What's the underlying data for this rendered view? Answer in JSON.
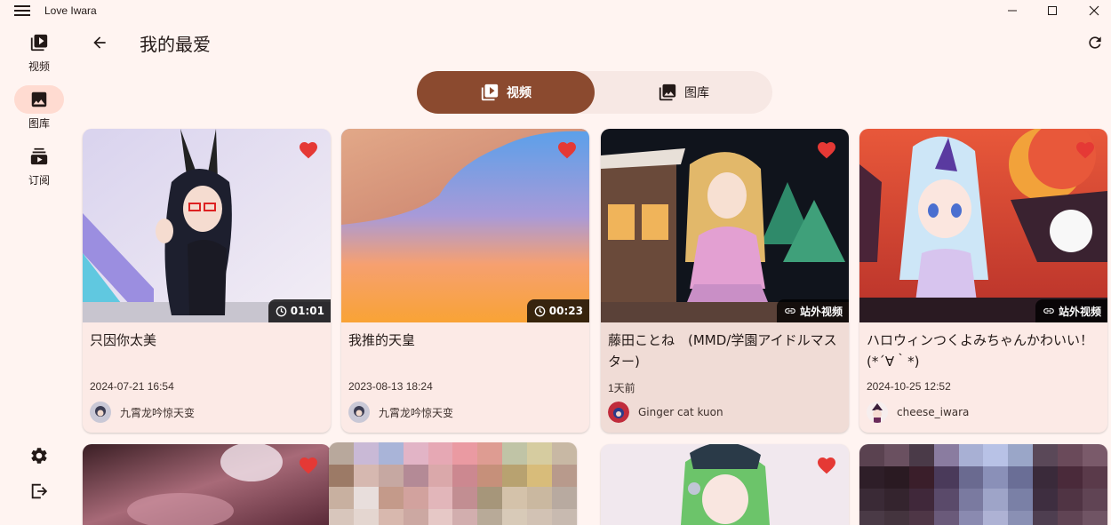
{
  "window": {
    "title": "Love Iwara"
  },
  "rail": {
    "items": [
      {
        "label": "视频",
        "icon": "video-library-icon",
        "active": false
      },
      {
        "label": "图库",
        "icon": "image-icon",
        "active": true
      },
      {
        "label": "订阅",
        "icon": "subscriptions-icon",
        "active": false
      }
    ],
    "bottom": [
      {
        "icon": "settings-icon"
      },
      {
        "icon": "logout-icon"
      }
    ]
  },
  "appbar": {
    "title": "我的最爱"
  },
  "segments": [
    {
      "label": "视频",
      "icon": "video-library-icon",
      "active": true
    },
    {
      "label": "图库",
      "icon": "image-icon",
      "active": false
    }
  ],
  "cards": [
    {
      "title": "只因你太美",
      "date": "2024-07-21 16:54",
      "author": "九霄龙吟惊天变",
      "badge": "01:01",
      "badge_type": "duration"
    },
    {
      "title": "我推的天皇",
      "date": "2023-08-13 18:24",
      "author": "九霄龙吟惊天变",
      "badge": "00:23",
      "badge_type": "duration"
    },
    {
      "title": "藤田ことね　(MMD/学園アイドルマスター)",
      "date": "1天前",
      "author": "Ginger cat kuon",
      "badge": "站外视频",
      "badge_type": "external"
    },
    {
      "title": "ハロウィンつくよみちゃんかわいい！(*´∀｀*)",
      "date": "2024-10-25 12:52",
      "author": "cheese_iwara",
      "badge": "站外视频",
      "badge_type": "external"
    }
  ],
  "colors": {
    "background": "#fff4f1",
    "accent": "#8b4a2f",
    "heart": "#e53935",
    "card": "#fceae6",
    "active_pill": "#ffdbd1"
  }
}
